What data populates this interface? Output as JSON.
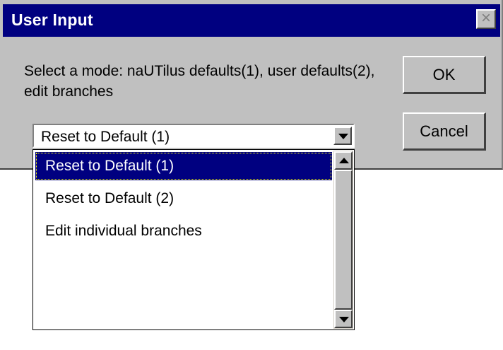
{
  "dialog": {
    "title": "User Input",
    "close_icon": "close-icon",
    "prompt": "Select a mode: naUTilus defaults(1), user defaults(2), edit branches",
    "ok_label": "OK",
    "cancel_label": "Cancel"
  },
  "combo": {
    "selected_value": "Reset to Default (1)",
    "icon": "chevron-down-icon"
  },
  "dropdown": {
    "options": [
      {
        "label": "Reset to Default (1)",
        "selected": true
      },
      {
        "label": "Reset to Default (2)",
        "selected": false
      },
      {
        "label": "Edit individual branches",
        "selected": false
      }
    ],
    "scroll_up_icon": "arrow-up-icon",
    "scroll_down_icon": "arrow-down-icon"
  },
  "colors": {
    "titlebar": "#000080",
    "dialog_face": "#c0c0c0",
    "selection": "#000080"
  }
}
